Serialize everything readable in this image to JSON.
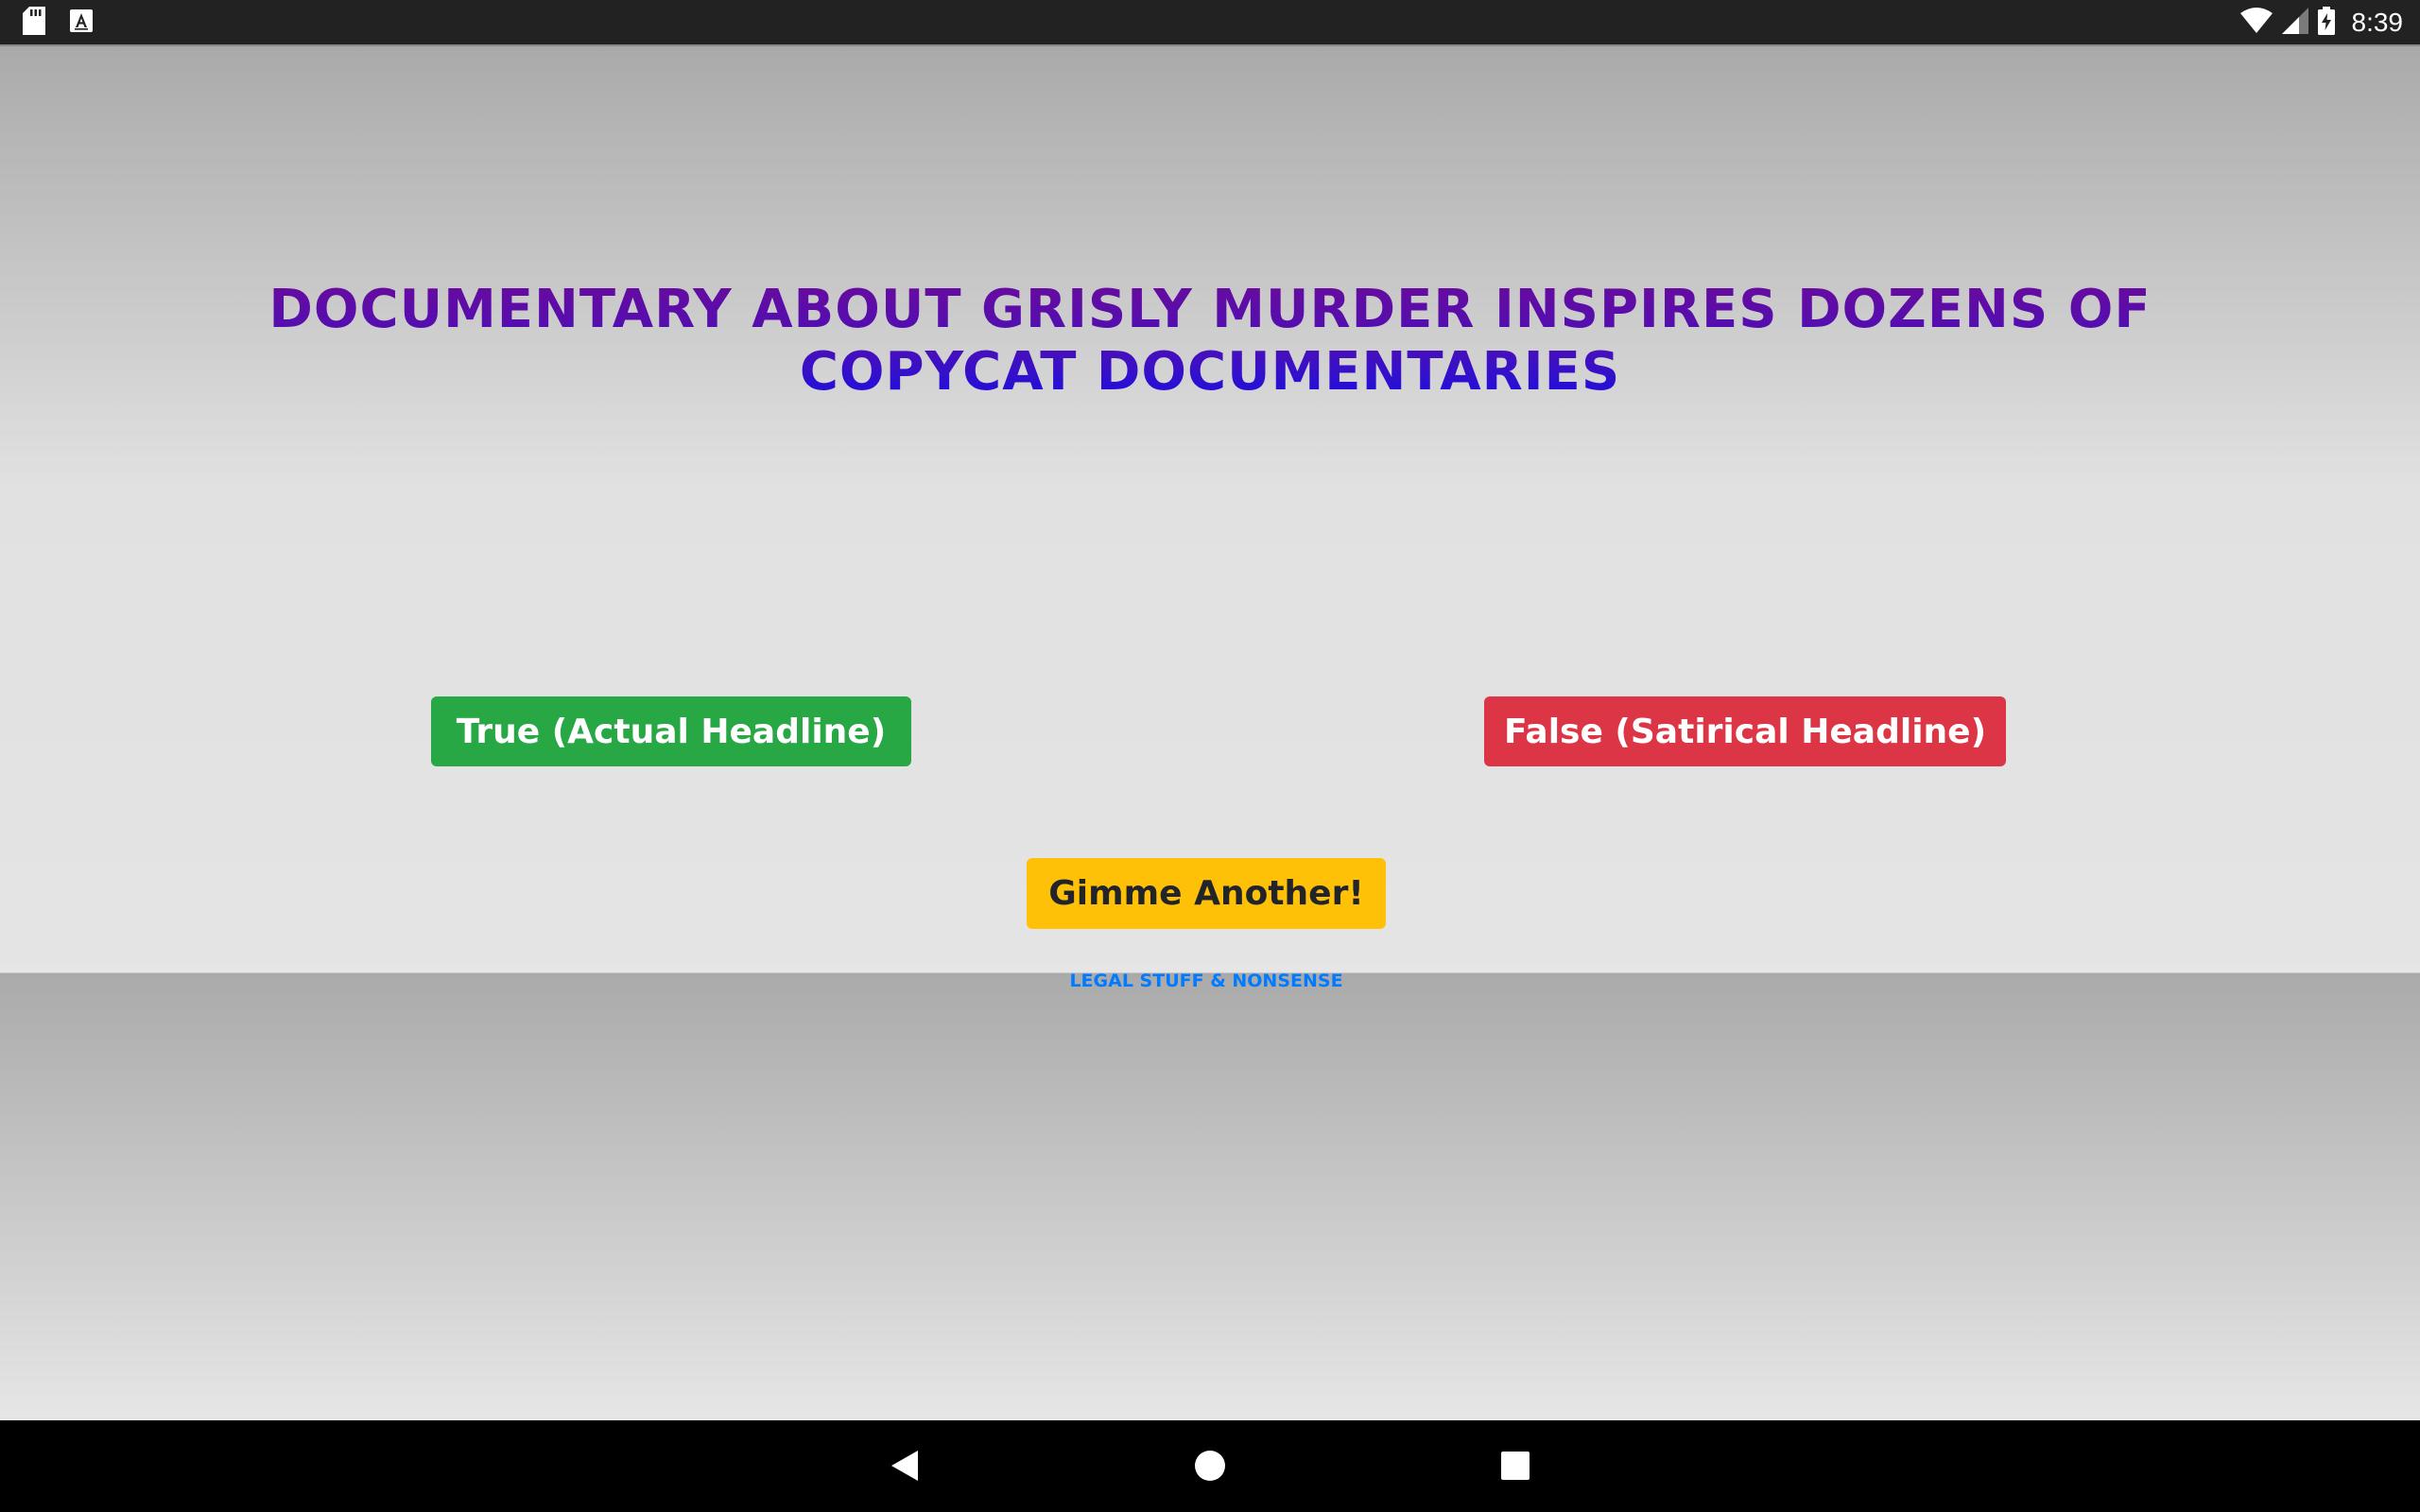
{
  "status_bar": {
    "left_icons": [
      "sd-card-icon",
      "text-a-icon"
    ],
    "right_icons": [
      "wifi-icon",
      "cell-signal-icon",
      "battery-charging-icon"
    ],
    "time": "8:39"
  },
  "headline": {
    "text": "Documentary About Grisly Murder Inspires Dozens Of Copycat Documentaries",
    "colors": {
      "top": "#6a0a9c",
      "bottom": "#1a0fe0"
    }
  },
  "buttons": {
    "true_label": "True (Actual Headline)",
    "false_label": "False (Satirical Headline)",
    "another_label": "Gimme Another!"
  },
  "footer": {
    "legal_link": "LEGAL STUFF & NONSENSE"
  },
  "nav_bar": {
    "icons": [
      "back-triangle-icon",
      "home-circle-icon",
      "recents-square-icon"
    ]
  },
  "colors": {
    "true_button": "#28a745",
    "false_button": "#dc3545",
    "another_button": "#ffc107",
    "link": "#007bff"
  }
}
